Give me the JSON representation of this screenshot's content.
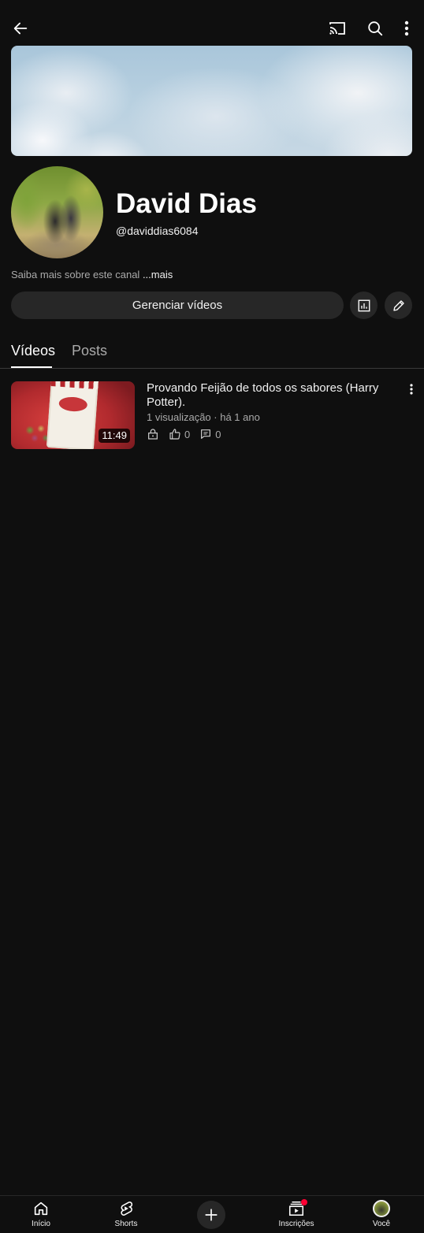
{
  "topbar": {
    "icons": [
      "back-arrow-icon",
      "cast-icon",
      "search-icon",
      "more-vertical-icon"
    ]
  },
  "channel": {
    "name": "David Dias",
    "handle": "@daviddias6084",
    "about_text": "Saiba mais sobre este canal ",
    "about_more": "...mais",
    "manage_button": "Gerenciar vídeos"
  },
  "tabs": [
    {
      "label": "Vídeos",
      "selected": true
    },
    {
      "label": "Posts",
      "selected": false
    }
  ],
  "videos": [
    {
      "title": "Provando Feijão de todos os sabores (Harry Potter).",
      "meta": "1 visualização · há 1 ano",
      "duration": "11:49",
      "likes": "0",
      "comments": "0",
      "visibility_icon": "lock-icon"
    }
  ],
  "bottom_nav": {
    "home": "Início",
    "shorts": "Shorts",
    "subscriptions": "Inscrições",
    "you": "Você"
  },
  "colors": {
    "background": "#0f0f0f",
    "surface": "#272727",
    "text": "#f1f1f1",
    "secondary_text": "#aaaaaa",
    "notification_dot": "#ff0033"
  }
}
